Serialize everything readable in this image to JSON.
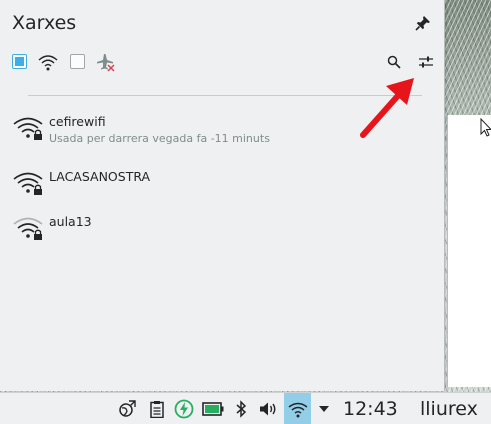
{
  "popup": {
    "title": "Xarxes",
    "toolbar": {
      "wifi_checkbox_checked": true,
      "airplane_checkbox_checked": false,
      "icons": [
        "wifi-icon",
        "airplane-mode-icon",
        "search-icon",
        "settings-sliders-icon",
        "pin-icon"
      ]
    },
    "networks": [
      {
        "name": "cefirewifi",
        "status": "Usada per darrera vegada fa -11 minuts",
        "secured": true
      },
      {
        "name": "LACASANOSTRA",
        "status": "",
        "secured": true
      },
      {
        "name": "aula13",
        "status": "",
        "secured": true
      }
    ]
  },
  "taskbar": {
    "time": "12:43",
    "user": "lliurex",
    "tray_icons": [
      "network-globe-icon",
      "clipboard-icon",
      "battery-charging-icon",
      "keyboard-battery-icon",
      "bluetooth-icon",
      "volume-icon",
      "wifi-tray-icon",
      "expand-arrow-icon"
    ]
  },
  "colors": {
    "accent": "#3daee9",
    "active_tray": "#93cee9",
    "annotation_arrow": "#e8141c",
    "panel_bg": "#eff0f1"
  }
}
